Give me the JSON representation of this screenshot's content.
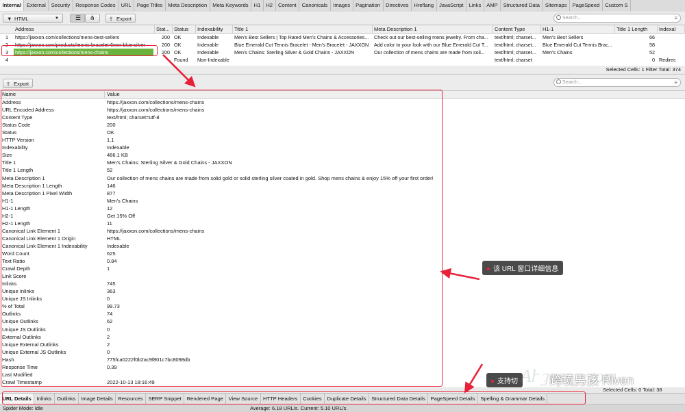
{
  "tabs": [
    "Internal",
    "External",
    "Security",
    "Response Codes",
    "URL",
    "Page Titles",
    "Meta Description",
    "Meta Keywords",
    "H1",
    "H2",
    "Content",
    "Canonicals",
    "Images",
    "Pagination",
    "Directives",
    "Hreflang",
    "JavaScript",
    "Links",
    "AMP",
    "Structured Data",
    "Sitemaps",
    "PageSpeed",
    "Custom S"
  ],
  "toolbar": {
    "filter_value": "HTML",
    "export_label": "Export",
    "search_placeholder": "Search..."
  },
  "top_table": {
    "headers": [
      "Address",
      "Stat...",
      "Status",
      "Indexability",
      "Title 1",
      "Meta Description 1",
      "Content Type",
      "H1-1",
      "Title 1 Length",
      "Indexal"
    ],
    "rows": [
      {
        "n": "1",
        "address": "https://jaxxon.com/collections/mens-best-sellers",
        "code": "200",
        "status": "OK",
        "indexability": "Indexable",
        "title": "Men's Best Sellers | Top Rated Men's Chains & Accessories...",
        "meta": "Check out our best-selling mens jewelry. From cha...",
        "ctype": "text/html; charset...",
        "h1": "Men's Best Sellers",
        "tlen": "66",
        "idx": ""
      },
      {
        "n": "2",
        "address": "https://jaxxon.com/products/tennis-bracelet-6mm-blue-silver",
        "code": "200",
        "status": "OK",
        "indexability": "Indexable",
        "title": "Blue Emerald Cut Tennis Bracelet - Men's Bracelet - JAXXON",
        "meta": "Add color to your look with our Blue Emerald Cut T...",
        "ctype": "text/html; charset...",
        "h1": "Blue Emerald Cut Tennis Brac...",
        "tlen": "58",
        "idx": ""
      },
      {
        "n": "3",
        "address": "https://jaxxon.com/collections/mens-chains",
        "code": "200",
        "status": "OK",
        "indexability": "Indexable",
        "title": "Men's Chains: Sterling Silver & Gold Chains - JAXXON",
        "meta": "Our collection of mens chains are made from soli...",
        "ctype": "text/html; charset...",
        "h1": "Men's Chains",
        "tlen": "52",
        "idx": ""
      },
      {
        "n": "4",
        "address": "",
        "code": "",
        "status": "Found",
        "indexability": "Non-Indexable",
        "title": "",
        "meta": "",
        "ctype": "text/html; charset",
        "h1": "",
        "tlen": "0",
        "idx": "Redirec"
      }
    ],
    "status_text": "Selected Cells: 1  Filter Total: 374"
  },
  "lower": {
    "export_label": "Export",
    "search_placeholder": "Search..."
  },
  "details": {
    "headers": [
      "Name",
      "Value"
    ],
    "rows": [
      [
        "Address",
        "https://jaxxon.com/collections/mens-chains"
      ],
      [
        "URL Encoded Address",
        "https://jaxxon.com/collections/mens-chains"
      ],
      [
        "Content Type",
        "text/html; charset=utf-8"
      ],
      [
        "Status Code",
        "200"
      ],
      [
        "Status",
        "OK"
      ],
      [
        "HTTP Version",
        "1.1"
      ],
      [
        "Indexability",
        "Indexable"
      ],
      [
        "Size",
        "486.1 KB"
      ],
      [
        "Title 1",
        "Men's Chains: Sterling Silver & Gold Chains - JAXXON"
      ],
      [
        "Title 1 Length",
        "52"
      ],
      [
        "Meta Description 1",
        "Our collection of mens chains are made from solid gold or solid sterling silver coated in gold. Shop mens chains & enjoy 15% off your first order!"
      ],
      [
        "Meta Description 1 Length",
        "146"
      ],
      [
        "Meta Description 1 Pixel Width",
        "877"
      ],
      [
        "H1-1",
        "Men's Chains"
      ],
      [
        "H1-1 Length",
        "12"
      ],
      [
        "H2-1",
        "Get 15% Off"
      ],
      [
        "H2-1 Length",
        "11"
      ],
      [
        "Canonical Link Element 1",
        "https://jaxxon.com/collections/mens-chains"
      ],
      [
        "Canonical Link Element 1 Origin",
        "HTML"
      ],
      [
        "Canonical Link Element 1 Indexability",
        "Indexable"
      ],
      [
        "Word Count",
        "625"
      ],
      [
        "Text Ratio",
        "0.84"
      ],
      [
        "Crawl Depth",
        "1"
      ],
      [
        "Link Score",
        ""
      ],
      [
        "Inlinks",
        "745"
      ],
      [
        "Unique Inlinks",
        "363"
      ],
      [
        "Unique JS Inlinks",
        "0"
      ],
      [
        "% of Total",
        "99.73"
      ],
      [
        "Outlinks",
        "74"
      ],
      [
        "Unique Outlinks",
        "62"
      ],
      [
        "Unique JS Outlinks",
        "0"
      ],
      [
        "External Outlinks",
        "2"
      ],
      [
        "Unique External Outlinks",
        "2"
      ],
      [
        "Unique External JS Outlinks",
        "0"
      ],
      [
        "Hash",
        "775fca0222f0b2ac9f801c7bc8098db"
      ],
      [
        "Response Time",
        "0.39"
      ],
      [
        "Last Modified",
        ""
      ],
      [
        "Crawl Timestamp",
        "2022-10-13 18:16:49"
      ]
    ],
    "status_text": "Selected Cells: 0  Total: 38"
  },
  "bottom_tabs": [
    "URL Details",
    "Inlinks",
    "Outlinks",
    "Image Details",
    "Resources",
    "SERP Snippet",
    "Rendered Page",
    "View Source",
    "HTTP Headers",
    "Cookies",
    "Duplicate Details",
    "Structured Data Details",
    "PageSpeed Details",
    "Spelling & Grammar Details"
  ],
  "footer": {
    "mode": "Spider Mode: Idle",
    "speed": "Average: 6.18 URL/s. Current: 5.10 URL/s."
  },
  "annotations": {
    "callout_1": "该 URL 窗口详细信息",
    "callout_2": "支持切",
    "wechat": "跨境男孩 Riven",
    "watermark": "Ahgosuu.com"
  },
  "colors": {
    "accent_red": "#e8213a",
    "selected_row": "#6ab43e"
  }
}
